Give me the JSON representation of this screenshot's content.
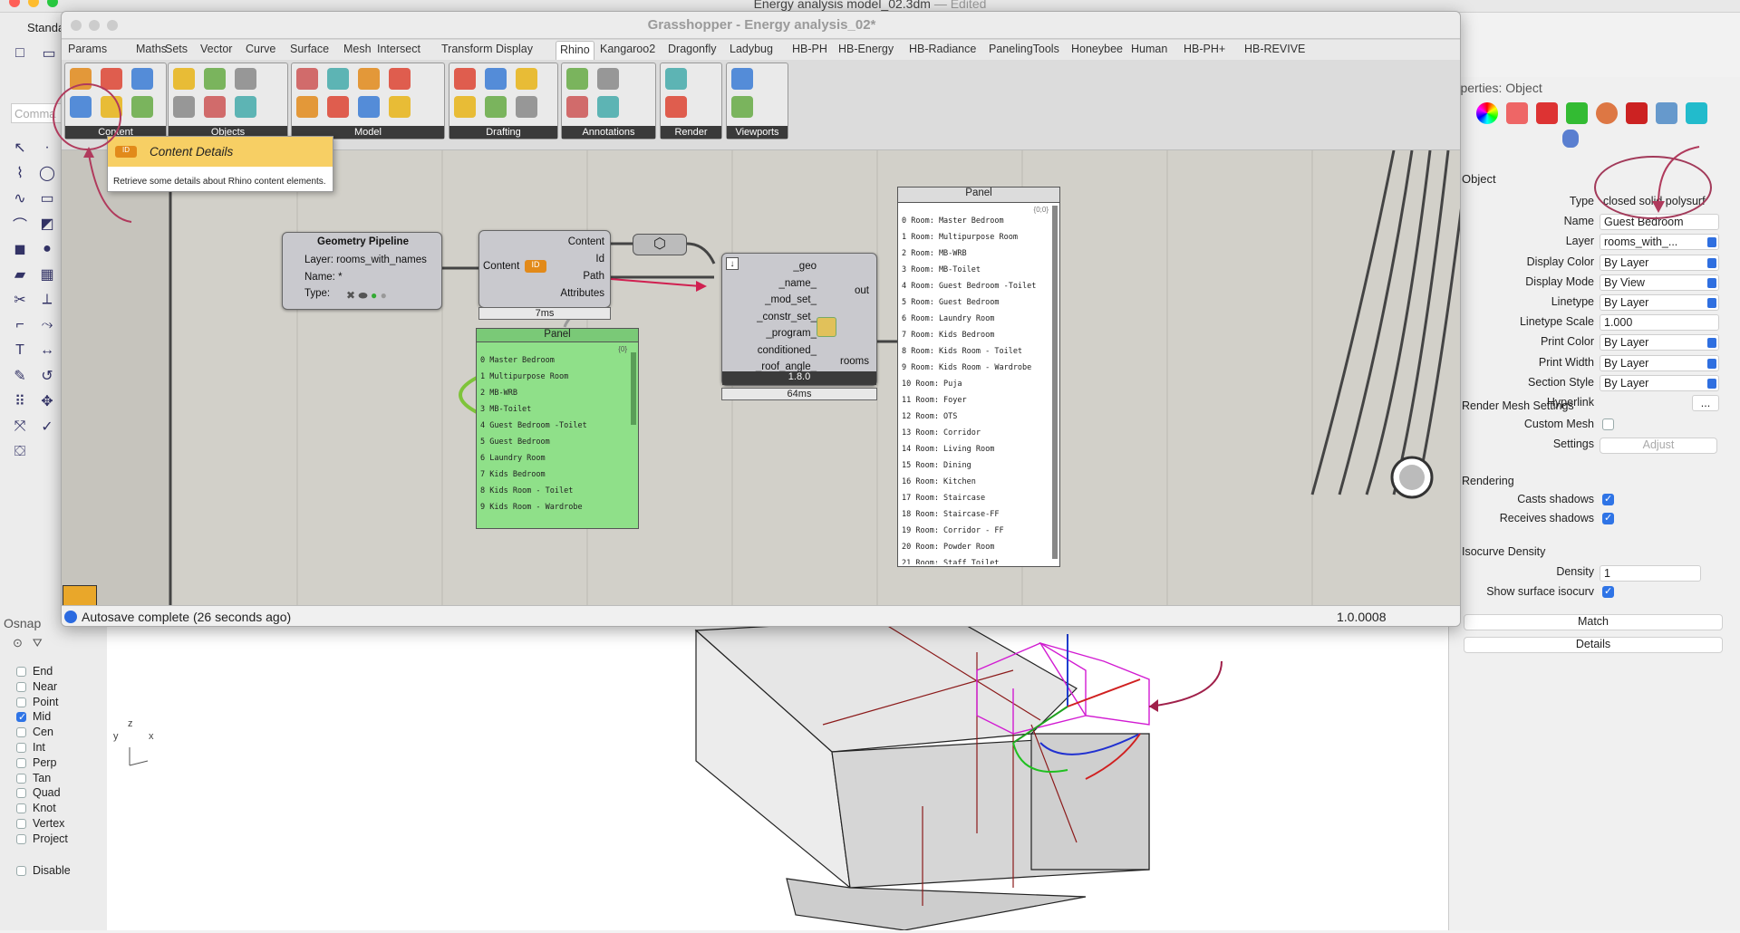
{
  "mac": {
    "title": "Energy analysis model_02.3dm",
    "edited": "— Edited"
  },
  "rhino": {
    "toolbar_label": "Standa",
    "command_placeholder": "Comma"
  },
  "gh": {
    "title": "Grasshopper - Energy analysis_02*",
    "tabs": [
      "Params",
      "Maths",
      "Sets",
      "Vector",
      "Curve",
      "Surface",
      "Mesh",
      "Intersect",
      "Transform",
      "Display",
      "Rhino",
      "Kangaroo2",
      "Dragonfly",
      "Ladybug",
      "HB-PH",
      "HB-Energy",
      "HB-Radiance",
      "PanelingTools",
      "Honeybee",
      "Human",
      "HB-PH+",
      "HB-REVIVE"
    ],
    "active_tab": "Rhino",
    "groups": [
      "Content",
      "Objects",
      "Model",
      "Drafting",
      "Annotations",
      "Render",
      "Viewports"
    ],
    "tooltip": {
      "title": "Content Details",
      "body": "Retrieve some details about Rhino content elements."
    },
    "pipeline": {
      "title": "Geometry Pipeline",
      "layer": "Layer: rooms_with_names",
      "name": "Name: *",
      "type": "Type:"
    },
    "content_details": {
      "input": "Content",
      "outputs": [
        "Content",
        "Id",
        "Path",
        "Attributes"
      ],
      "time": "7ms"
    },
    "room_comp": {
      "inputs": [
        "_geo",
        "_name_",
        "_mod_set_",
        "_constr_set_",
        "_program_",
        "conditioned_",
        "_roof_angle_"
      ],
      "outputs": [
        "out",
        "rooms"
      ],
      "version": "1.8.0",
      "time": "64ms"
    },
    "green_panel": {
      "title": "Panel",
      "path": "{0}",
      "rows": [
        "Master Bedroom",
        "Multipurpose Room",
        "MB-WRB",
        "MB-Toilet",
        "Guest Bedroom -Toilet",
        "Guest Bedroom",
        "Laundry Room",
        "Kids Bedroom",
        "Kids Room - Toilet",
        "Kids Room - Wardrobe"
      ]
    },
    "white_panel": {
      "title": "Panel",
      "path": "{0;0}",
      "rows": [
        "Room: Master Bedroom",
        "Room: Multipurpose Room",
        "Room: MB-WRB",
        "Room: MB-Toilet",
        "Room: Guest Bedroom -Toilet",
        "Room: Guest Bedroom",
        "Room: Laundry Room",
        "Room: Kids Bedroom",
        "Room: Kids Room - Toilet",
        "Room: Kids Room - Wardrobe",
        "Room: Puja",
        "Room: Foyer",
        "Room: OTS",
        "Room: Corridor",
        "Room: Living Room",
        "Room: Dining",
        "Room: Kitchen",
        "Room: Staircase",
        "Room: Staircase-FF",
        "Room: Corridor - FF",
        "Room: Powder Room",
        "Room: Staff Toilet"
      ]
    },
    "status": "Autosave complete (26 seconds ago)",
    "version": "1.0.0008"
  },
  "props": {
    "header": "roperties: Object",
    "object_label": "Object",
    "fields": [
      {
        "label": "Type",
        "value": "closed solid polysurf"
      },
      {
        "label": "Name",
        "value": "Guest Bedroom"
      },
      {
        "label": "Layer",
        "value": "rooms_with_..."
      },
      {
        "label": "Display Color",
        "value": "By Layer"
      },
      {
        "label": "Display Mode",
        "value": "By View"
      },
      {
        "label": "Linetype",
        "value": "By Layer"
      },
      {
        "label": "Linetype Scale",
        "value": "1.000"
      },
      {
        "label": "Print Color",
        "value": "By Layer"
      },
      {
        "label": "Print Width",
        "value": "By Layer"
      },
      {
        "label": "Section Style",
        "value": "By Layer"
      },
      {
        "label": "Hyperlink",
        "value": "..."
      }
    ],
    "render_mesh": "Render Mesh Settings",
    "custom_mesh": "Custom Mesh",
    "settings": "Settings",
    "adjust": "Adjust",
    "rendering": "Rendering",
    "casts": "Casts shadows",
    "receives": "Receives shadows",
    "isocurve": "Isocurve Density",
    "density": "Density",
    "density_value": "1",
    "show_iso": "Show surface isocurv",
    "match": "Match",
    "details": "Details"
  },
  "osnap": {
    "title": "Osnap",
    "items": [
      {
        "label": "End",
        "on": false
      },
      {
        "label": "Near",
        "on": false
      },
      {
        "label": "Point",
        "on": false
      },
      {
        "label": "Mid",
        "on": true
      },
      {
        "label": "Cen",
        "on": false
      },
      {
        "label": "Int",
        "on": false
      },
      {
        "label": "Perp",
        "on": false
      },
      {
        "label": "Tan",
        "on": false
      },
      {
        "label": "Quad",
        "on": false
      },
      {
        "label": "Knot",
        "on": false
      },
      {
        "label": "Vertex",
        "on": false
      },
      {
        "label": "Project",
        "on": false
      }
    ],
    "disable": "Disable"
  },
  "axes": {
    "x": "x",
    "y": "y",
    "z": "z"
  }
}
